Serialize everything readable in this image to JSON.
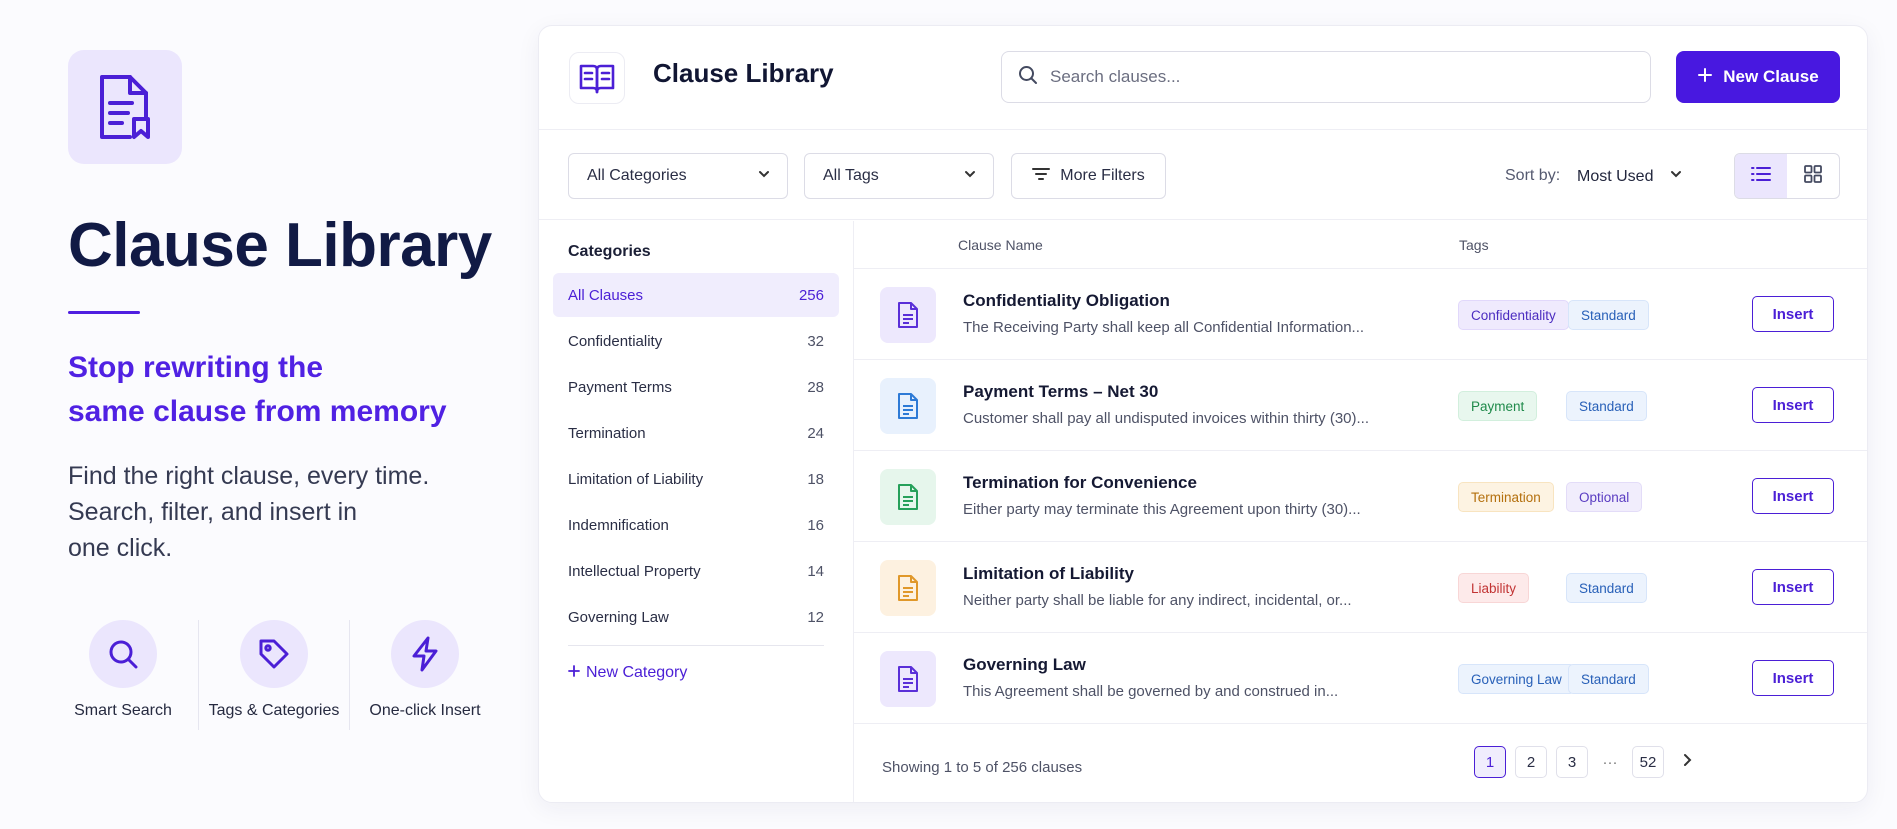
{
  "hero": {
    "title": "Clause Library",
    "tagline_line1": "Stop rewriting the",
    "tagline_line2": "same clause from memory",
    "desc_line1": "Find the right clause, every time.",
    "desc_line2": "Search, filter, and insert in",
    "desc_line3": "one click.",
    "features": [
      {
        "label": "Smart Search",
        "icon": "search-icon"
      },
      {
        "label": "Tags & Categories",
        "icon": "tag-icon"
      },
      {
        "label": "One-click Insert",
        "icon": "lightning-icon"
      }
    ]
  },
  "header": {
    "title": "Clause Library",
    "search_placeholder": "Search clauses...",
    "new_clause_label": "New Clause"
  },
  "filters": {
    "category": "All Categories",
    "tags": "All Tags",
    "more": "More Filters",
    "sort_label": "Sort by:",
    "sort_value": "Most Used"
  },
  "sidebar": {
    "heading": "Categories",
    "items": [
      {
        "label": "All Clauses",
        "count": "256"
      },
      {
        "label": "Confidentiality",
        "count": "32"
      },
      {
        "label": "Payment Terms",
        "count": "28"
      },
      {
        "label": "Termination",
        "count": "24"
      },
      {
        "label": "Limitation of Liability",
        "count": "18"
      },
      {
        "label": "Indemnification",
        "count": "16"
      },
      {
        "label": "Intellectual Property",
        "count": "14"
      },
      {
        "label": "Governing Law",
        "count": "12"
      }
    ],
    "new_category": "New Category"
  },
  "table": {
    "col_name": "Clause Name",
    "col_tags": "Tags",
    "insert_label": "Insert",
    "rows": [
      {
        "title": "Confidentiality Obligation",
        "desc": "The Receiving Party shall keep all Confidential Information...",
        "tag1": "Confidentiality",
        "tag2": "Standard"
      },
      {
        "title": "Payment Terms – Net 30",
        "desc": "Customer shall pay all undisputed invoices within thirty (30)...",
        "tag1": "Payment",
        "tag2": "Standard"
      },
      {
        "title": "Termination for Convenience",
        "desc": "Either party may terminate this Agreement upon thirty (30)...",
        "tag1": "Termination",
        "tag2": "Optional"
      },
      {
        "title": "Limitation of Liability",
        "desc": "Neither party shall be liable for any indirect, incidental, or...",
        "tag1": "Liability",
        "tag2": "Standard"
      },
      {
        "title": "Governing Law",
        "desc": "This Agreement shall be governed by and construed in...",
        "tag1": "Governing Law",
        "tag2": "Standard"
      }
    ]
  },
  "footer": {
    "showing": "Showing 1 to 5 of 256 clauses",
    "pages": [
      "1",
      "2",
      "3",
      "52"
    ],
    "ellipsis": "···"
  },
  "colors": {
    "accent": "#4818e0",
    "accent_light": "#ebe6fd"
  }
}
